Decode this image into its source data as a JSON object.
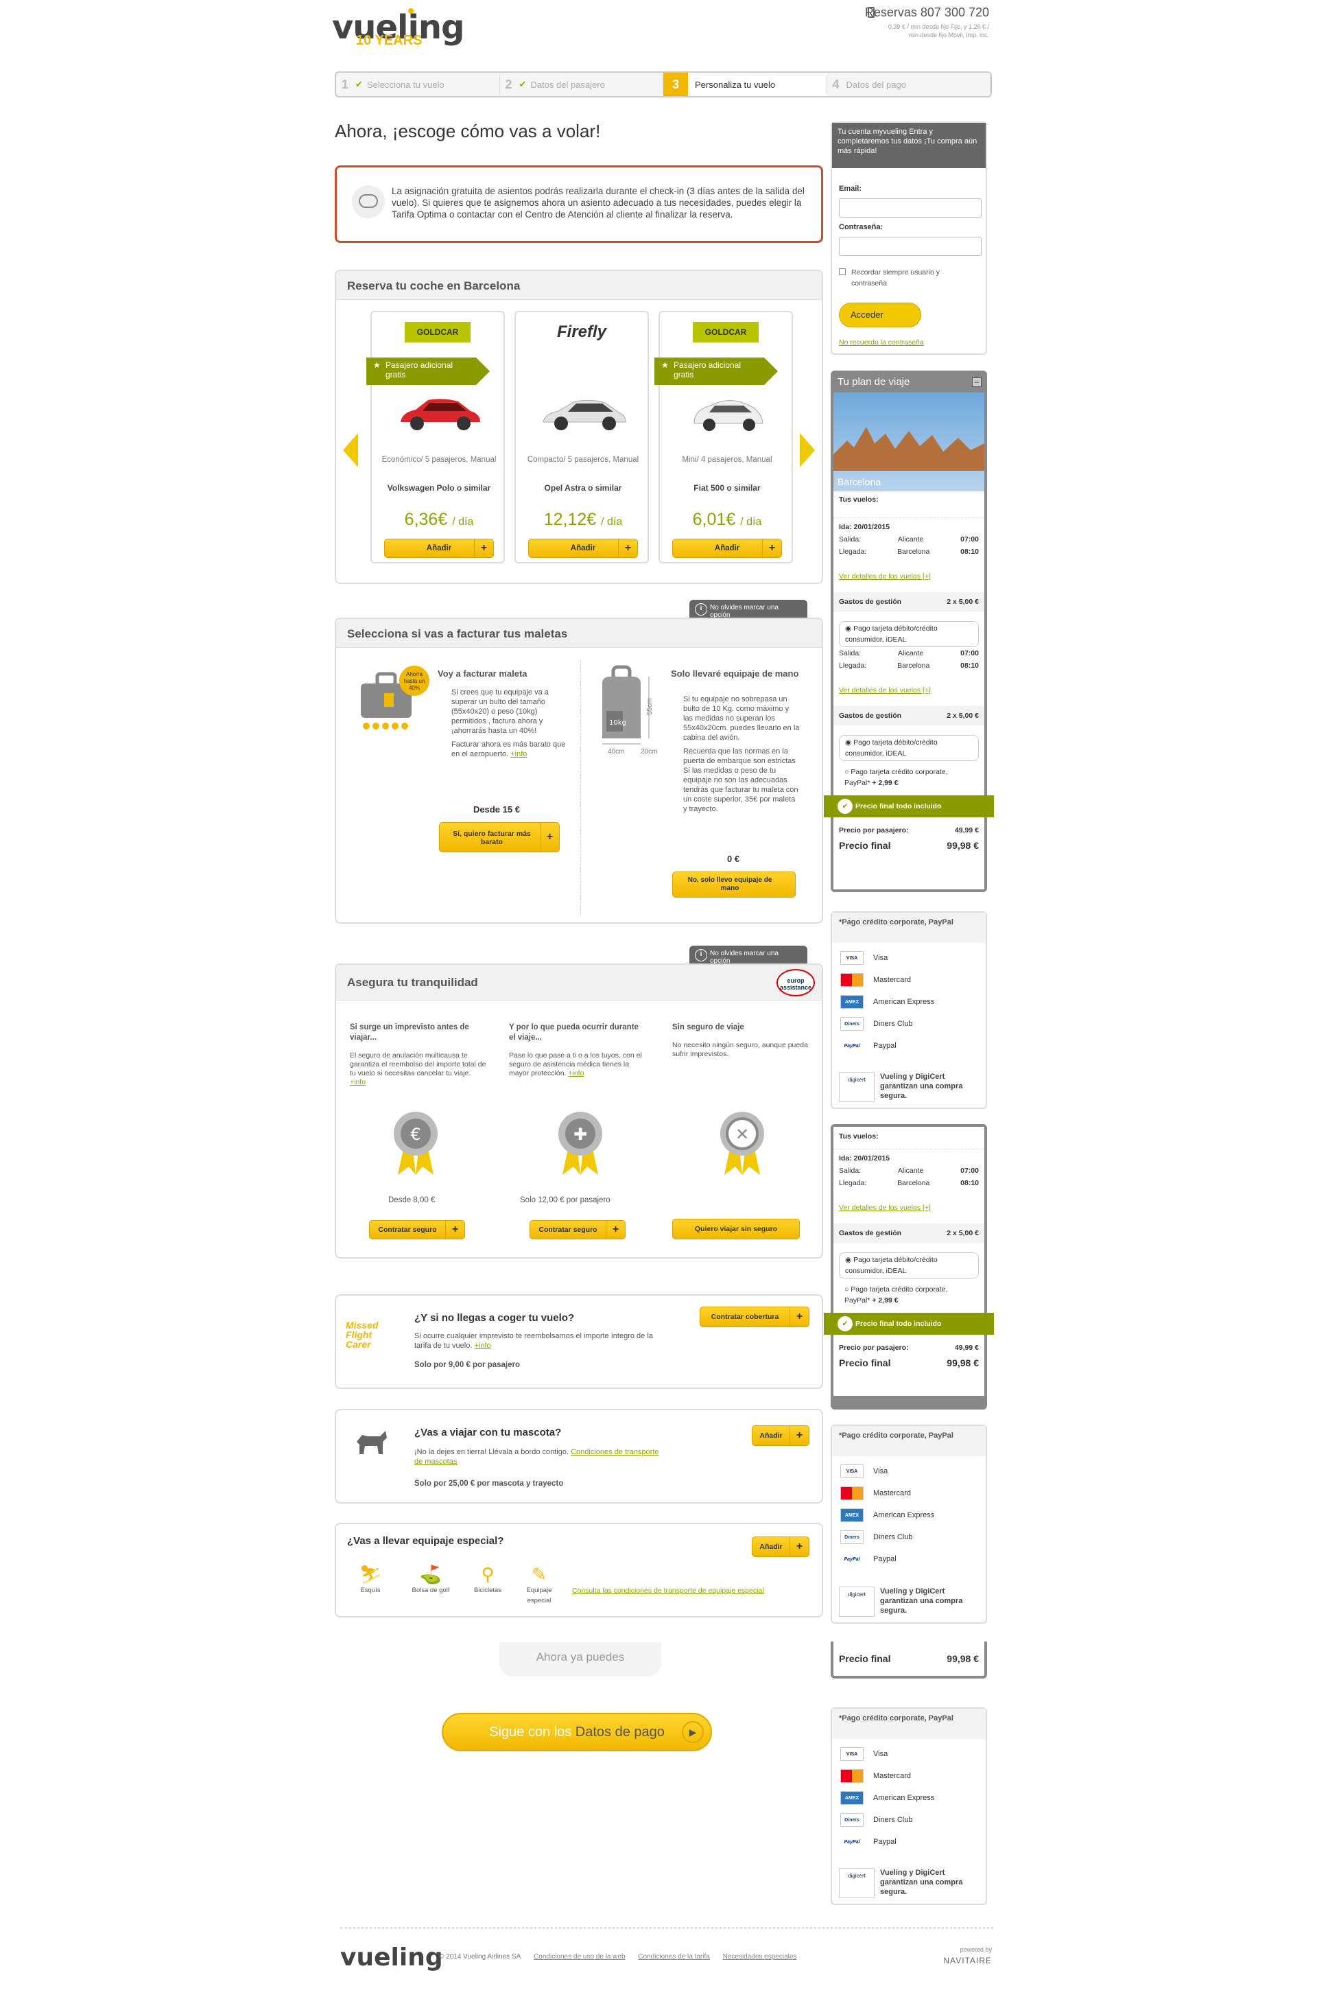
{
  "header": {
    "logo": "vueling",
    "logo_sub": "10 YEARS",
    "phone": "Reservas 807 300 720",
    "phone_note": "0,39 € / min desde fijo Fijo, y 1,26 € / min desde fijo Movil, imp. inc."
  },
  "steps": [
    {
      "num": "1",
      "label": "Selecciona tu vuelo",
      "done": true
    },
    {
      "num": "2",
      "label": "Datos del pasajero",
      "done": true
    },
    {
      "num": "3",
      "label": "Personaliza tu vuelo",
      "done": false
    },
    {
      "num": "4",
      "label": "Datos del pago",
      "done": false
    }
  ],
  "title": "Ahora, ¡escoge cómo vas a volar!",
  "notice": "La asignación gratuita de asientos podrás realizarla durante el check-in (3 días antes de la salida del vuelo). Si quieres que te asignemos ahora un asiento adecuado a tus necesidades, puedes elegir la Tarifa Optima o contactar con el Centro de Atención al cliente al finalizar la reserva.",
  "cars": {
    "title": "Reserva tu coche en Barcelona",
    "items": [
      {
        "brand": "GOLDCAR",
        "tag": "Pasajero adicional gratis",
        "type": "Económico/ 5 pasajeros, Manual",
        "model": "Volkswagen Polo o similar",
        "price": "6,36€",
        "per": "/ día",
        "btn": "Añadir",
        "color": "#d8262b"
      },
      {
        "brand": "Firefly",
        "tag": "",
        "type": "Compacto/ 5 pasajeros, Manual",
        "model": "Opel Astra o similar",
        "price": "12,12€",
        "per": "/ día",
        "btn": "Añadir",
        "color": "#dcdcdc"
      },
      {
        "brand": "GOLDCAR",
        "tag": "Pasajero adicional gratis",
        "type": "Mini/ 4 pasajeros, Manual",
        "model": "Fiat 500 o similar",
        "price": "6,01€",
        "per": "/ día",
        "btn": "Añadir",
        "color": "#e8e8e8"
      }
    ]
  },
  "tip_label": "No olvides marcar una opción",
  "bags": {
    "title": "Selecciona si vas a facturar tus maletas",
    "badge": "Ahorra hasta un 40%",
    "left_title": "Voy a facturar maleta",
    "left_b1": "Si crees que tu equipaje va a superar un bulto del tamaño (55x40x20) o peso (10kg) permitidos , factura ahora y ¡ahorrarás hasta un 40%!",
    "left_b2": "Facturar ahora es más barato que en el aeropuerto.",
    "left_more": "+info",
    "left_price": "Desde 15 €",
    "left_btn": "Sí, quiero facturar más barato",
    "right_title": "Solo llevaré equipaje de mano",
    "right_b1": "Si tu equipaje no sobrepasa un bulto de 10 Kg. como máximo y las medidas no superan los 55x40x20cm. puedes llevarlo en la cabina del avión.",
    "right_b2": "Recuerda que las normas en la puerta de embarque son estrictas Si las medidas o peso de tu equipaje no son las adecuadas tendrás que facturar tu maleta con un coste superior, 35€ por maleta y trayecto.",
    "right_price": "0 €",
    "right_btn": "No, solo llevo equipaje de mano",
    "dims": {
      "h": "55cm",
      "w": "40cm",
      "d": "20cm",
      "kg": "10kg"
    }
  },
  "insurance": {
    "title": "Asegura tu tranquilidad",
    "brand": "europ assistance",
    "cols": [
      {
        "title": "Si surge un imprevisto antes de viajar...",
        "text": "El seguro de anulación multicausa te garantiza el reembolso del importe total de tu vuelo si necesitas cancelar tu viaje.",
        "more": "+info",
        "price": "Desde 8,00 €",
        "btn": "Contratar seguro",
        "symbol": "€"
      },
      {
        "title": "Y por lo que pueda ocurrir durante el viaje...",
        "text": "Pase lo que pase a ti o a los tuyos, con el seguro de asistencia médica tienes la mayor protección.",
        "more": "+info",
        "price": "Solo 12,00 € por pasajero",
        "btn": "Contratar seguro",
        "symbol": "✚"
      },
      {
        "title": "Sin seguro de viaje",
        "text": "No necesito ningún seguro, aunque pueda sufrir imprevistos.",
        "more": "",
        "price": "",
        "btn": "Quiero viajar sin seguro",
        "symbol": "✕"
      }
    ]
  },
  "missed": {
    "logo": "Missed Flight Carer",
    "title": "¿Y si no llegas a coger tu vuelo?",
    "text": "Si ocurre cualquier imprevisto te reembolsamos el importe íntegro de la tarifa de tu vuelo.",
    "more": "+info",
    "price": "Solo por 9,00 € por pasajero",
    "btn": "Contratar cobertura"
  },
  "pet": {
    "title": "¿Vas a viajar con tu mascota?",
    "text": "¡No la dejes en tierra! Llévala a bordo contigo.",
    "link": "Condiciones de transporte de mascotas",
    "price": "Solo por 25,00 € por mascota y trayecto",
    "btn": "Añadir"
  },
  "special": {
    "title": "¿Vas a llevar equipaje especial?",
    "items": [
      "Esquís",
      "Bolsa de golf",
      "Bicicletas",
      "Equipaje especial"
    ],
    "link": "Consulta las condiciones de transporte de equipaje especial",
    "btn": "Añadir"
  },
  "cta": {
    "pre": "Ahora ya puedes",
    "btn_a": "Sigue con los ",
    "btn_b": "Datos de pago"
  },
  "login": {
    "head": "Tu cuenta myvueling Entra y completaremos tus datos ¡Tu compra aún más rápida!",
    "email": "Email:",
    "password": "Contraseña:",
    "remember": "Recordar siempre usuario y contraseña",
    "btn": "Acceder",
    "forgot": "No recuerdo la contraseña"
  },
  "plan": {
    "title": "Tu plan de viaje",
    "city": "Barcelona",
    "flights_label": "Tus vuelos:",
    "ida": "Ida: 20/01/2015",
    "salida": "Salida:",
    "llegada": "Llegada:",
    "from": "Alicante",
    "to": "Barcelona",
    "dep": "07:00",
    "arr": "08:10",
    "details": "Ver detalles de los vuelos [+]",
    "fees": "Gastos de gestión",
    "fees_val": "2 x 5,00 €",
    "pay1": "Pago tarjeta débito/crédito consumidor, iDEAL",
    "pay2": "Pago tarjeta crédito corporate, PayPal*",
    "pay2_extra": "+ 2,99 €",
    "final_banner": "Precio final todo incluido",
    "per_pax": "Precio por pasajero:",
    "per_pax_val": "49,99 €",
    "final": "Precio final",
    "final_val": "99,98 €"
  },
  "cards": {
    "note": "*Pago crédito corporate, PayPal",
    "list": [
      "Visa",
      "Mastercard",
      "American Express",
      "Diners Club",
      "Paypal"
    ],
    "secure": "Vueling y DigiCert garantizan una compra segura."
  },
  "footer": {
    "logo": "vueling",
    "copy": "© 2014 Vueling Airlines SA",
    "links": [
      "Condiciones de uso de la web",
      "Condiciones de la tarifa",
      "Necesidades especiales"
    ],
    "powered": "powered by",
    "navitaire": "NAVITAIRE"
  }
}
